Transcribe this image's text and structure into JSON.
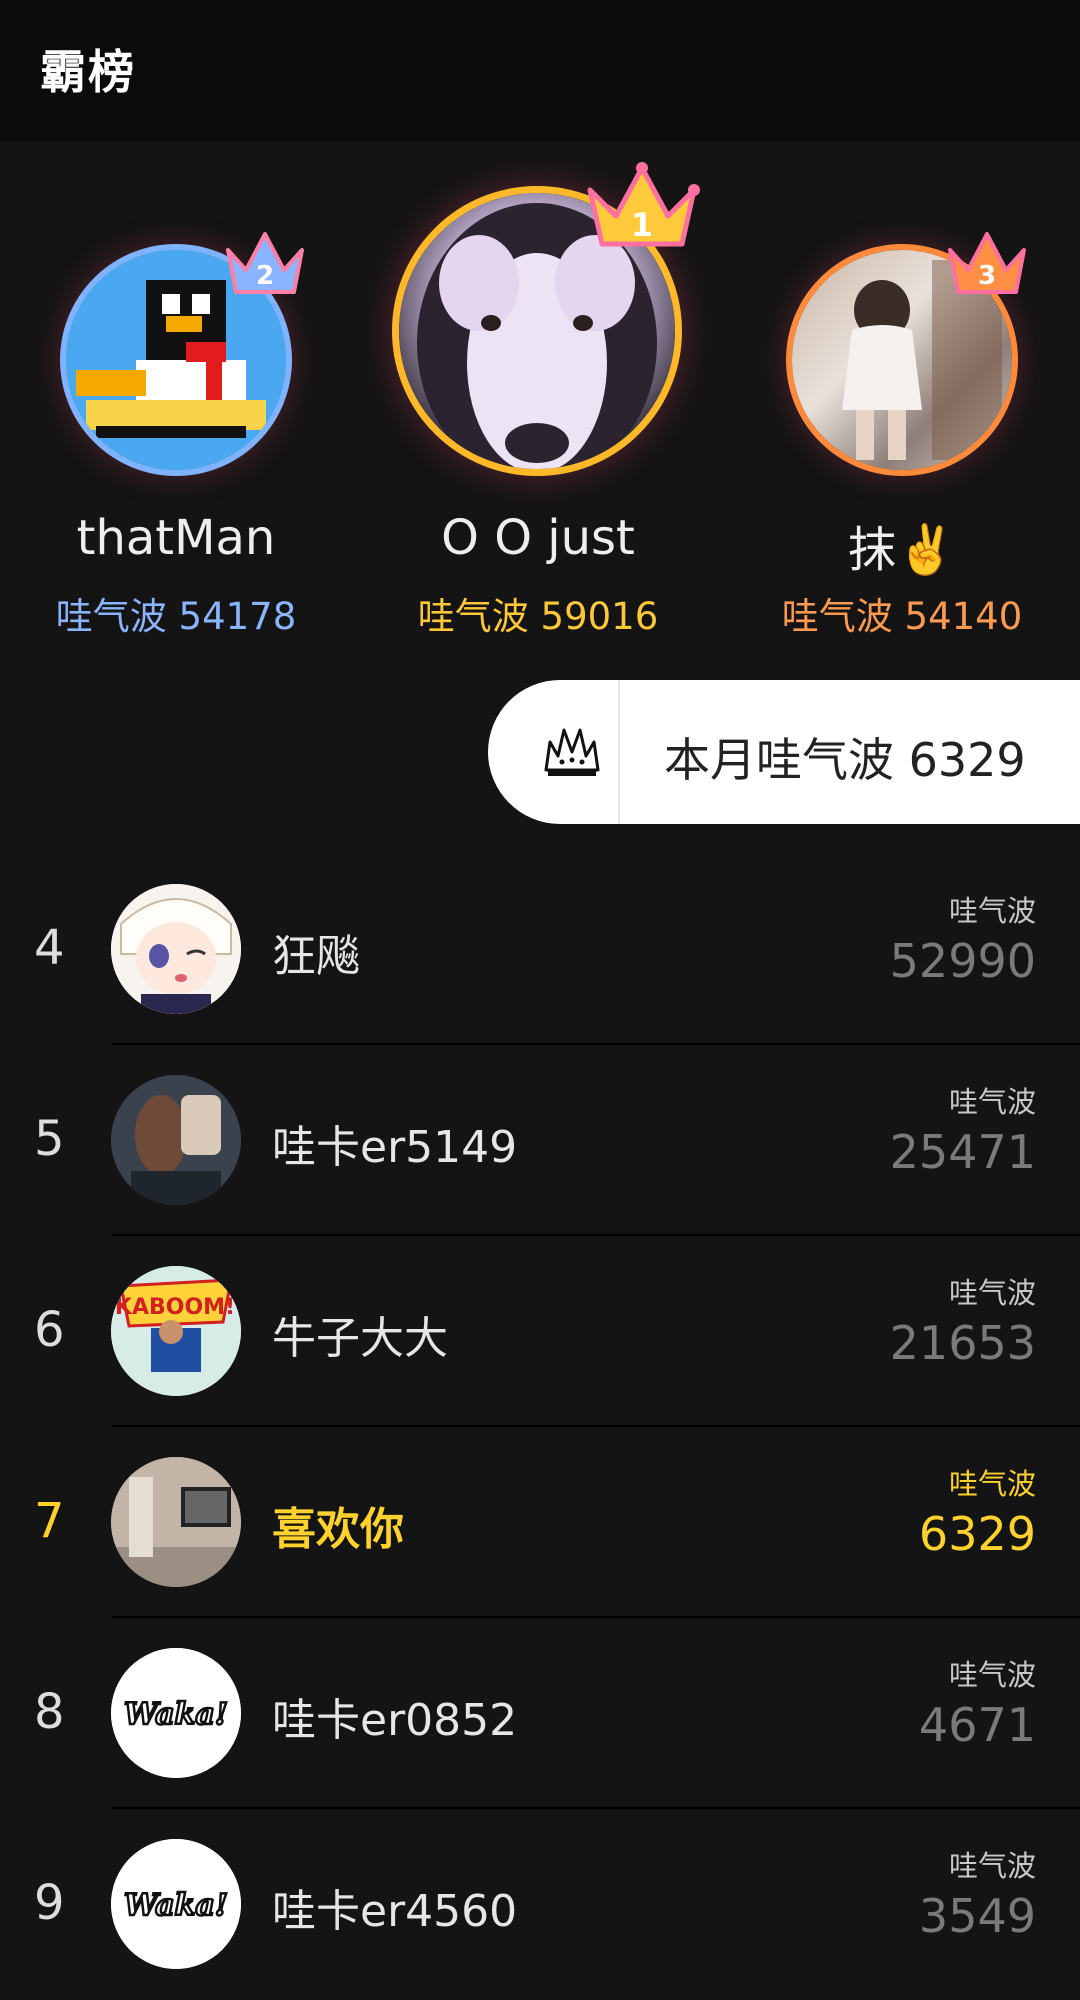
{
  "header": {
    "title": "霸榜"
  },
  "podium": [
    {
      "rank": "2",
      "name": "thatMan",
      "score_text": "哇气波 54178",
      "ring_color": "#7fb3ff",
      "score_color": "#8ab4ff",
      "avatar_icon": "penguin-pixel-avatar",
      "crown_color": "#8ab4ff"
    },
    {
      "rank": "1",
      "name": "O O just",
      "score_text": "哇气波 59016",
      "ring_color": "#ffb928",
      "score_color": "#ffc83a",
      "avatar_icon": "husky-avatar",
      "crown_color": "#ffc93c"
    },
    {
      "rank": "3",
      "name": "抹✌️",
      "score_text": "哇气波 54140",
      "ring_color": "#ff8a3c",
      "score_color": "#ff9a50",
      "avatar_icon": "girl-photo-avatar",
      "crown_color": "#ff8f45"
    }
  ],
  "month_banner": {
    "text": "本月哇气波 6329",
    "icon": "splash-crown-icon"
  },
  "rows": [
    {
      "rank": "4",
      "name": "狂飚",
      "label": "哇气波",
      "score": "52990",
      "avatar_icon": "anime-girl-avatar",
      "me": false
    },
    {
      "rank": "5",
      "name": "哇卡er5149",
      "label": "哇气波",
      "score": "25471",
      "avatar_icon": "photo-avatar",
      "me": false
    },
    {
      "rank": "6",
      "name": "牛子大大",
      "label": "哇气波",
      "score": "21653",
      "avatar_icon": "kaboom-comic-avatar",
      "me": false
    },
    {
      "rank": "7",
      "name": "喜欢你",
      "label": "哇气波",
      "score": "6329",
      "avatar_icon": "room-photo-avatar",
      "me": true
    },
    {
      "rank": "8",
      "name": "哇卡er0852",
      "label": "哇气波",
      "score": "4671",
      "avatar_icon": "waka-logo-avatar",
      "me": false
    },
    {
      "rank": "9",
      "name": "哇卡er4560",
      "label": "哇气波",
      "score": "3549",
      "avatar_icon": "waka-logo-avatar",
      "me": false
    }
  ],
  "avatar_text": {
    "waka": "Waka!",
    "kaboom": "KABOOM!"
  }
}
